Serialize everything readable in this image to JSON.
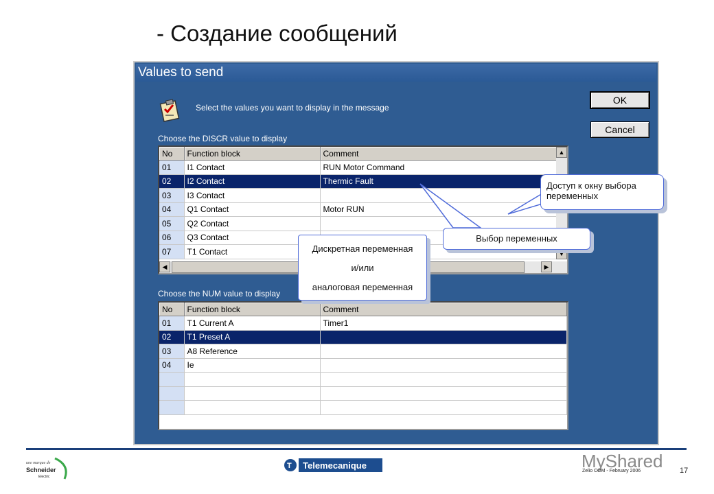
{
  "slide": {
    "title": "- Создание сообщений"
  },
  "dialog": {
    "title": "Values to send",
    "instruction": "Select the values you want to display in the message",
    "ok_label": "OK",
    "cancel_label": "Cancel",
    "discr_label": "Choose the DISCR value to display",
    "num_label": "Choose the NUM value to display",
    "columns": [
      "No",
      "Function block",
      "Comment"
    ],
    "discr_rows": [
      {
        "no": "01",
        "fb": "I1 Contact",
        "comment": "RUN Motor Command"
      },
      {
        "no": "02",
        "fb": "I2 Contact",
        "comment": "Thermic Fault"
      },
      {
        "no": "03",
        "fb": "I3 Contact",
        "comment": ""
      },
      {
        "no": "04",
        "fb": "Q1 Contact",
        "comment": "Motor RUN"
      },
      {
        "no": "05",
        "fb": "Q2 Contact",
        "comment": ""
      },
      {
        "no": "06",
        "fb": "Q3 Contact",
        "comment": ""
      },
      {
        "no": "07",
        "fb": "T1 Contact",
        "comment": ""
      }
    ],
    "num_rows": [
      {
        "no": "01",
        "fb": "T1 Current A",
        "comment": "Timer1"
      },
      {
        "no": "02",
        "fb": "T1 Preset A",
        "comment": ""
      },
      {
        "no": "03",
        "fb": "A8 Reference",
        "comment": ""
      },
      {
        "no": "04",
        "fb": "Ie",
        "comment": ""
      },
      {
        "no": "",
        "fb": "",
        "comment": ""
      },
      {
        "no": "",
        "fb": "",
        "comment": ""
      },
      {
        "no": "",
        "fb": "",
        "comment": ""
      }
    ]
  },
  "callouts": {
    "access": "Доступ к окну выбора переменных",
    "choice": "Выбор переменных",
    "var_line1": "Дискретная переменная",
    "var_line2": "и/или",
    "var_line3": "аналоговая переменная"
  },
  "footer": {
    "schneider_text": "une marque de Schneider Electric",
    "brand": "Telemecanique",
    "watermark": "MyShared",
    "note": "Zelio COM - February 2006",
    "page": "17"
  },
  "colors": {
    "dialog_bg": "#2f5c92",
    "selection": "#0a246a",
    "callout_border": "#4f6bd9"
  }
}
